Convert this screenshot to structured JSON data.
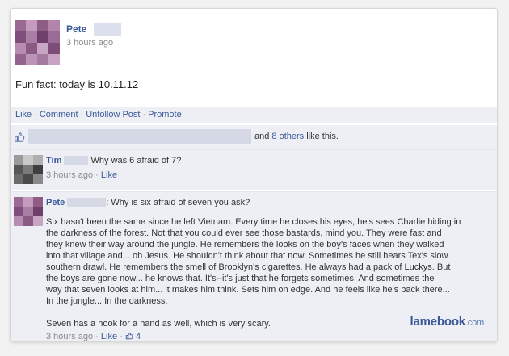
{
  "post": {
    "author": "Pete",
    "time": "3 hours ago",
    "text": "Fun fact: today is 10.11.12"
  },
  "actions": {
    "like": "Like",
    "comment": "Comment",
    "unfollow": "Unfollow Post",
    "promote": "Promote",
    "separator": "·"
  },
  "likes": {
    "and": "and",
    "others_link": "8 others",
    "suffix": "like this."
  },
  "comments": [
    {
      "author": "Tim",
      "text": "Why was 6 afraid of 7?",
      "time": "3 hours ago",
      "like": "Like"
    },
    {
      "author": "Pete",
      "intro": ": Why is six afraid of seven you ask?",
      "para1_lines": [
        "Six hasn't been the same since he left Vietnam. Every time he closes his eyes, he's sees Charlie hiding in",
        "the darkness of the forest. Not that you could ever see those bastards, mind you. They were fast and",
        "they knew their way around the jungle. He remembers the looks on the boy's faces when they walked",
        "into that village and... oh Jesus. He shouldn't think about that now. Sometimes he still hears Tex's slow",
        "southern drawl. He remembers the smell of Brooklyn's cigarettes. He always had a pack of Luckys. But",
        "the boys are gone now... he knows that. It's--it's just that he forgets sometimes. And sometimes the",
        "way that seven looks at him... it makes him think. Sets him on edge. And he feels like he's back there...",
        "In the jungle... In the darkness."
      ],
      "para2": "Seven has a hook for a hand as well, which is very scary.",
      "time": "3 hours ago",
      "like": "Like",
      "like_count": "4"
    }
  ],
  "watermark": {
    "brand": "lamebook",
    "tld": ".com"
  },
  "colors": {
    "link": "#3b5998",
    "muted": "#8a8a8a",
    "panel": "#edeff4"
  }
}
